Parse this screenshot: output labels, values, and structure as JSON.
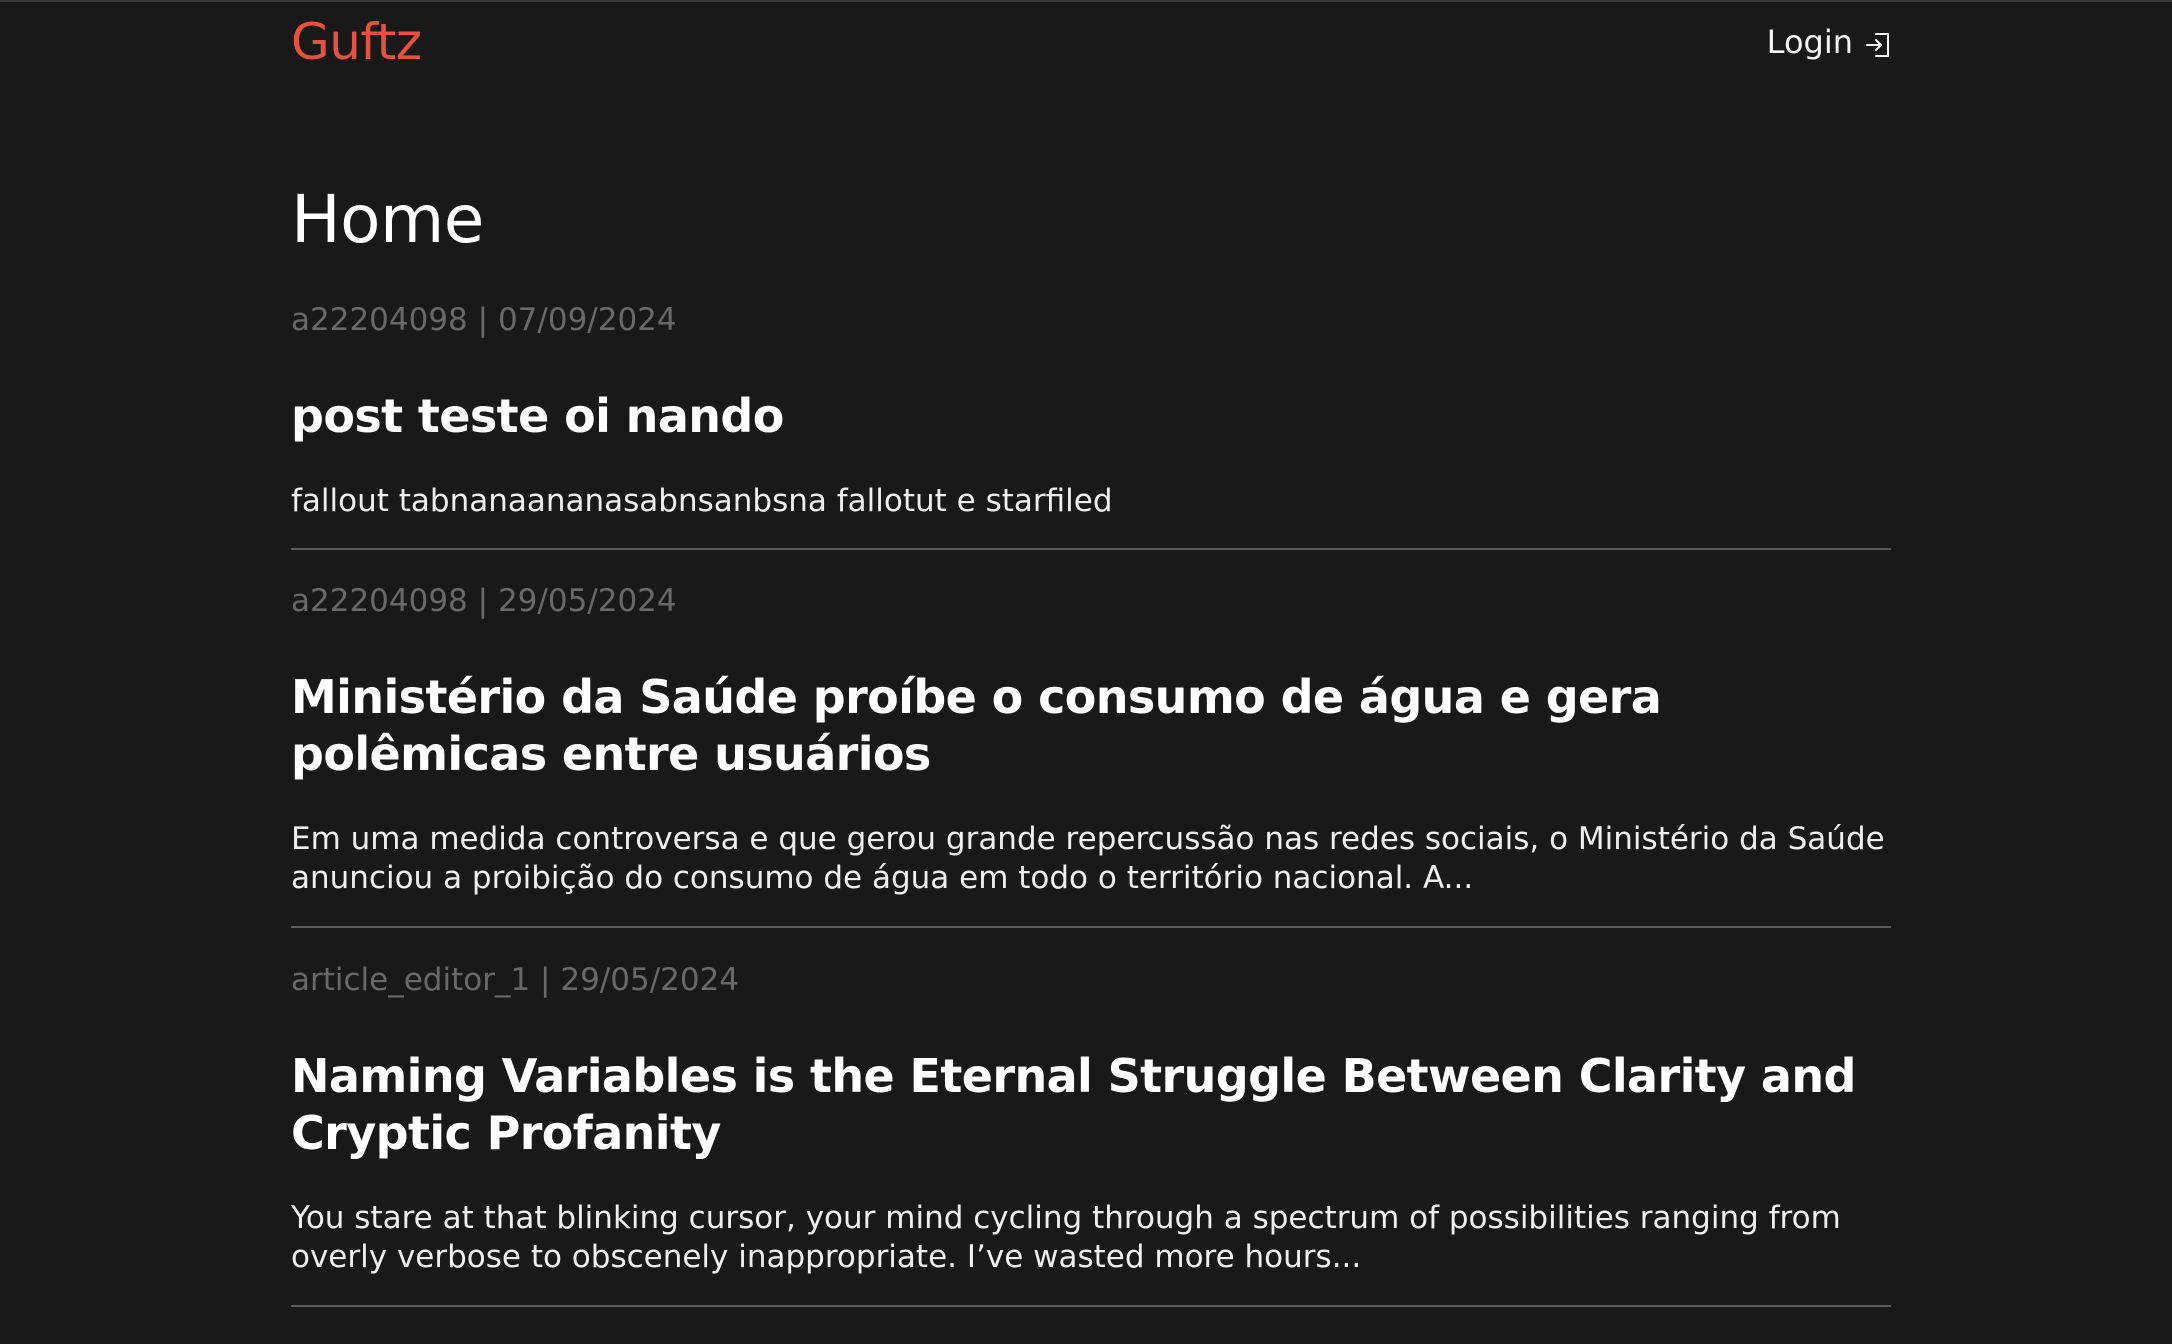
{
  "brand": {
    "name": "Guftz",
    "color": "#e8513e"
  },
  "nav": {
    "login_label": "Login",
    "login_icon": "login-icon"
  },
  "page": {
    "title": "Home"
  },
  "posts": [
    {
      "author": "a22204098",
      "date": "07/09/2024",
      "title": "post teste oi nando",
      "excerpt": "fallout tabnanaananasabnsanbsna fallotut e starfiled"
    },
    {
      "author": "a22204098",
      "date": "29/05/2024",
      "title": "Ministério da Saúde proíbe o consumo de água e gera polêmicas entre usuários",
      "excerpt": "Em uma medida controversa e que gerou grande repercussão nas redes sociais, o Ministério da Saúde anunciou a proibição do consumo de água em todo o território nacional. A..."
    },
    {
      "author": "article_editor_1",
      "date": "29/05/2024",
      "title": "Naming Variables is the Eternal Struggle Between Clarity and Cryptic Profanity",
      "excerpt": "You stare at that blinking cursor, your mind cycling through a spectrum of possibilities ranging from overly verbose to obscenely inappropriate. I’ve wasted more hours..."
    }
  ]
}
